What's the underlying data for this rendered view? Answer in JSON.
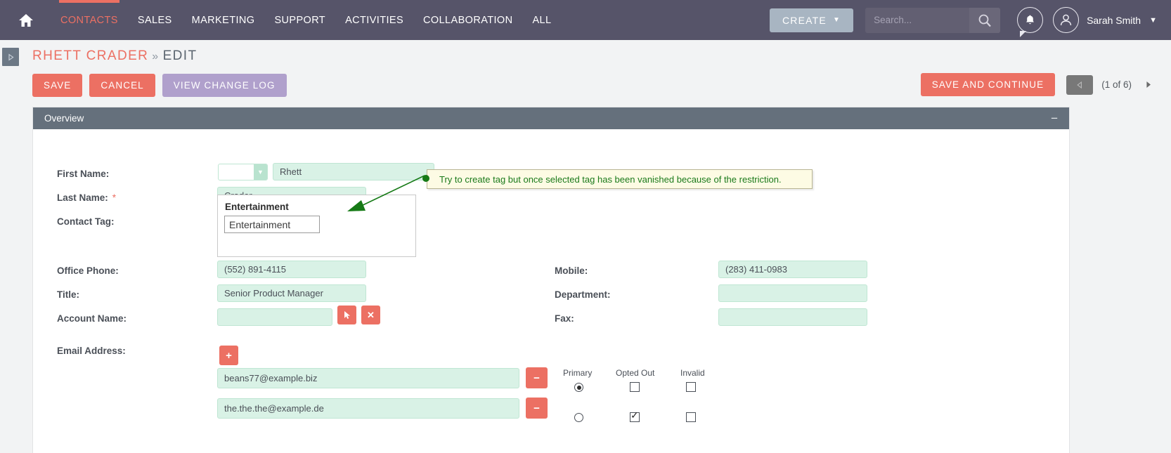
{
  "topnav": {
    "home_icon": "home-icon",
    "items": [
      {
        "label": "CONTACTS",
        "active": true
      },
      {
        "label": "SALES",
        "active": false
      },
      {
        "label": "MARKETING",
        "active": false
      },
      {
        "label": "SUPPORT",
        "active": false
      },
      {
        "label": "ACTIVITIES",
        "active": false
      },
      {
        "label": "COLLABORATION",
        "active": false
      },
      {
        "label": "ALL",
        "active": false
      }
    ],
    "create_label": "CREATE",
    "create_caret": "▼",
    "search_placeholder": "Search...",
    "search_value": "",
    "user_name": "Sarah Smith",
    "user_caret": "▼",
    "accent_color": "#ec7063",
    "bar_color": "#565469"
  },
  "header": {
    "breadcrumb_record": "RHETT CRADER",
    "breadcrumb_separator": "»",
    "breadcrumb_action": "EDIT",
    "buttons": [
      {
        "label": "SAVE",
        "style": "red"
      },
      {
        "label": "CANCEL",
        "style": "red"
      },
      {
        "label": "VIEW CHANGE LOG",
        "style": "purple"
      }
    ],
    "save_continue_label": "SAVE AND CONTINUE",
    "pager_prev_icon": "triangle-left-icon",
    "pager_label": "(1 of 6)",
    "pager_next_icon": "triangle-right-icon",
    "sidebar_toggle_icon": "triangle-right-icon"
  },
  "panel": {
    "title": "Overview",
    "collapse_icon": "−"
  },
  "form": {
    "first_name": {
      "label": "First Name:",
      "salutation_value": "",
      "salutation_caret": "▼",
      "value": "Rhett"
    },
    "last_name": {
      "label": "Last Name:",
      "required_marker": "*",
      "value": "Crader"
    },
    "contact_tag": {
      "label": "Contact Tag:",
      "group_title": "Entertainment",
      "input_value": "Entertainment"
    },
    "office_phone": {
      "label": "Office Phone:",
      "value": "(552) 891-4115"
    },
    "title": {
      "label": "Title:",
      "value": "Senior Product Manager"
    },
    "account_name": {
      "label": "Account Name:",
      "value": "",
      "select_icon": "arrow-cursor-icon",
      "clear_icon": "x-icon"
    },
    "mobile": {
      "label": "Mobile:",
      "value": "(283) 411-0983"
    },
    "department": {
      "label": "Department:",
      "value": ""
    },
    "fax": {
      "label": "Fax:",
      "value": ""
    },
    "email": {
      "label": "Email Address:",
      "add_icon": "plus-icon",
      "remove_icon": "minus-icon",
      "columns": [
        "Primary",
        "Opted Out",
        "Invalid"
      ],
      "rows": [
        {
          "value": "beans77@example.biz",
          "primary": true,
          "opted_out": false,
          "invalid": false
        },
        {
          "value": "the.the.the@example.de",
          "primary": false,
          "opted_out": true,
          "invalid": false
        }
      ]
    }
  },
  "annotation": {
    "text": "Try to create tag but once selected tag has been vanished because of the restriction.",
    "color": "#1a7a1a",
    "background": "#fdfbe4"
  }
}
